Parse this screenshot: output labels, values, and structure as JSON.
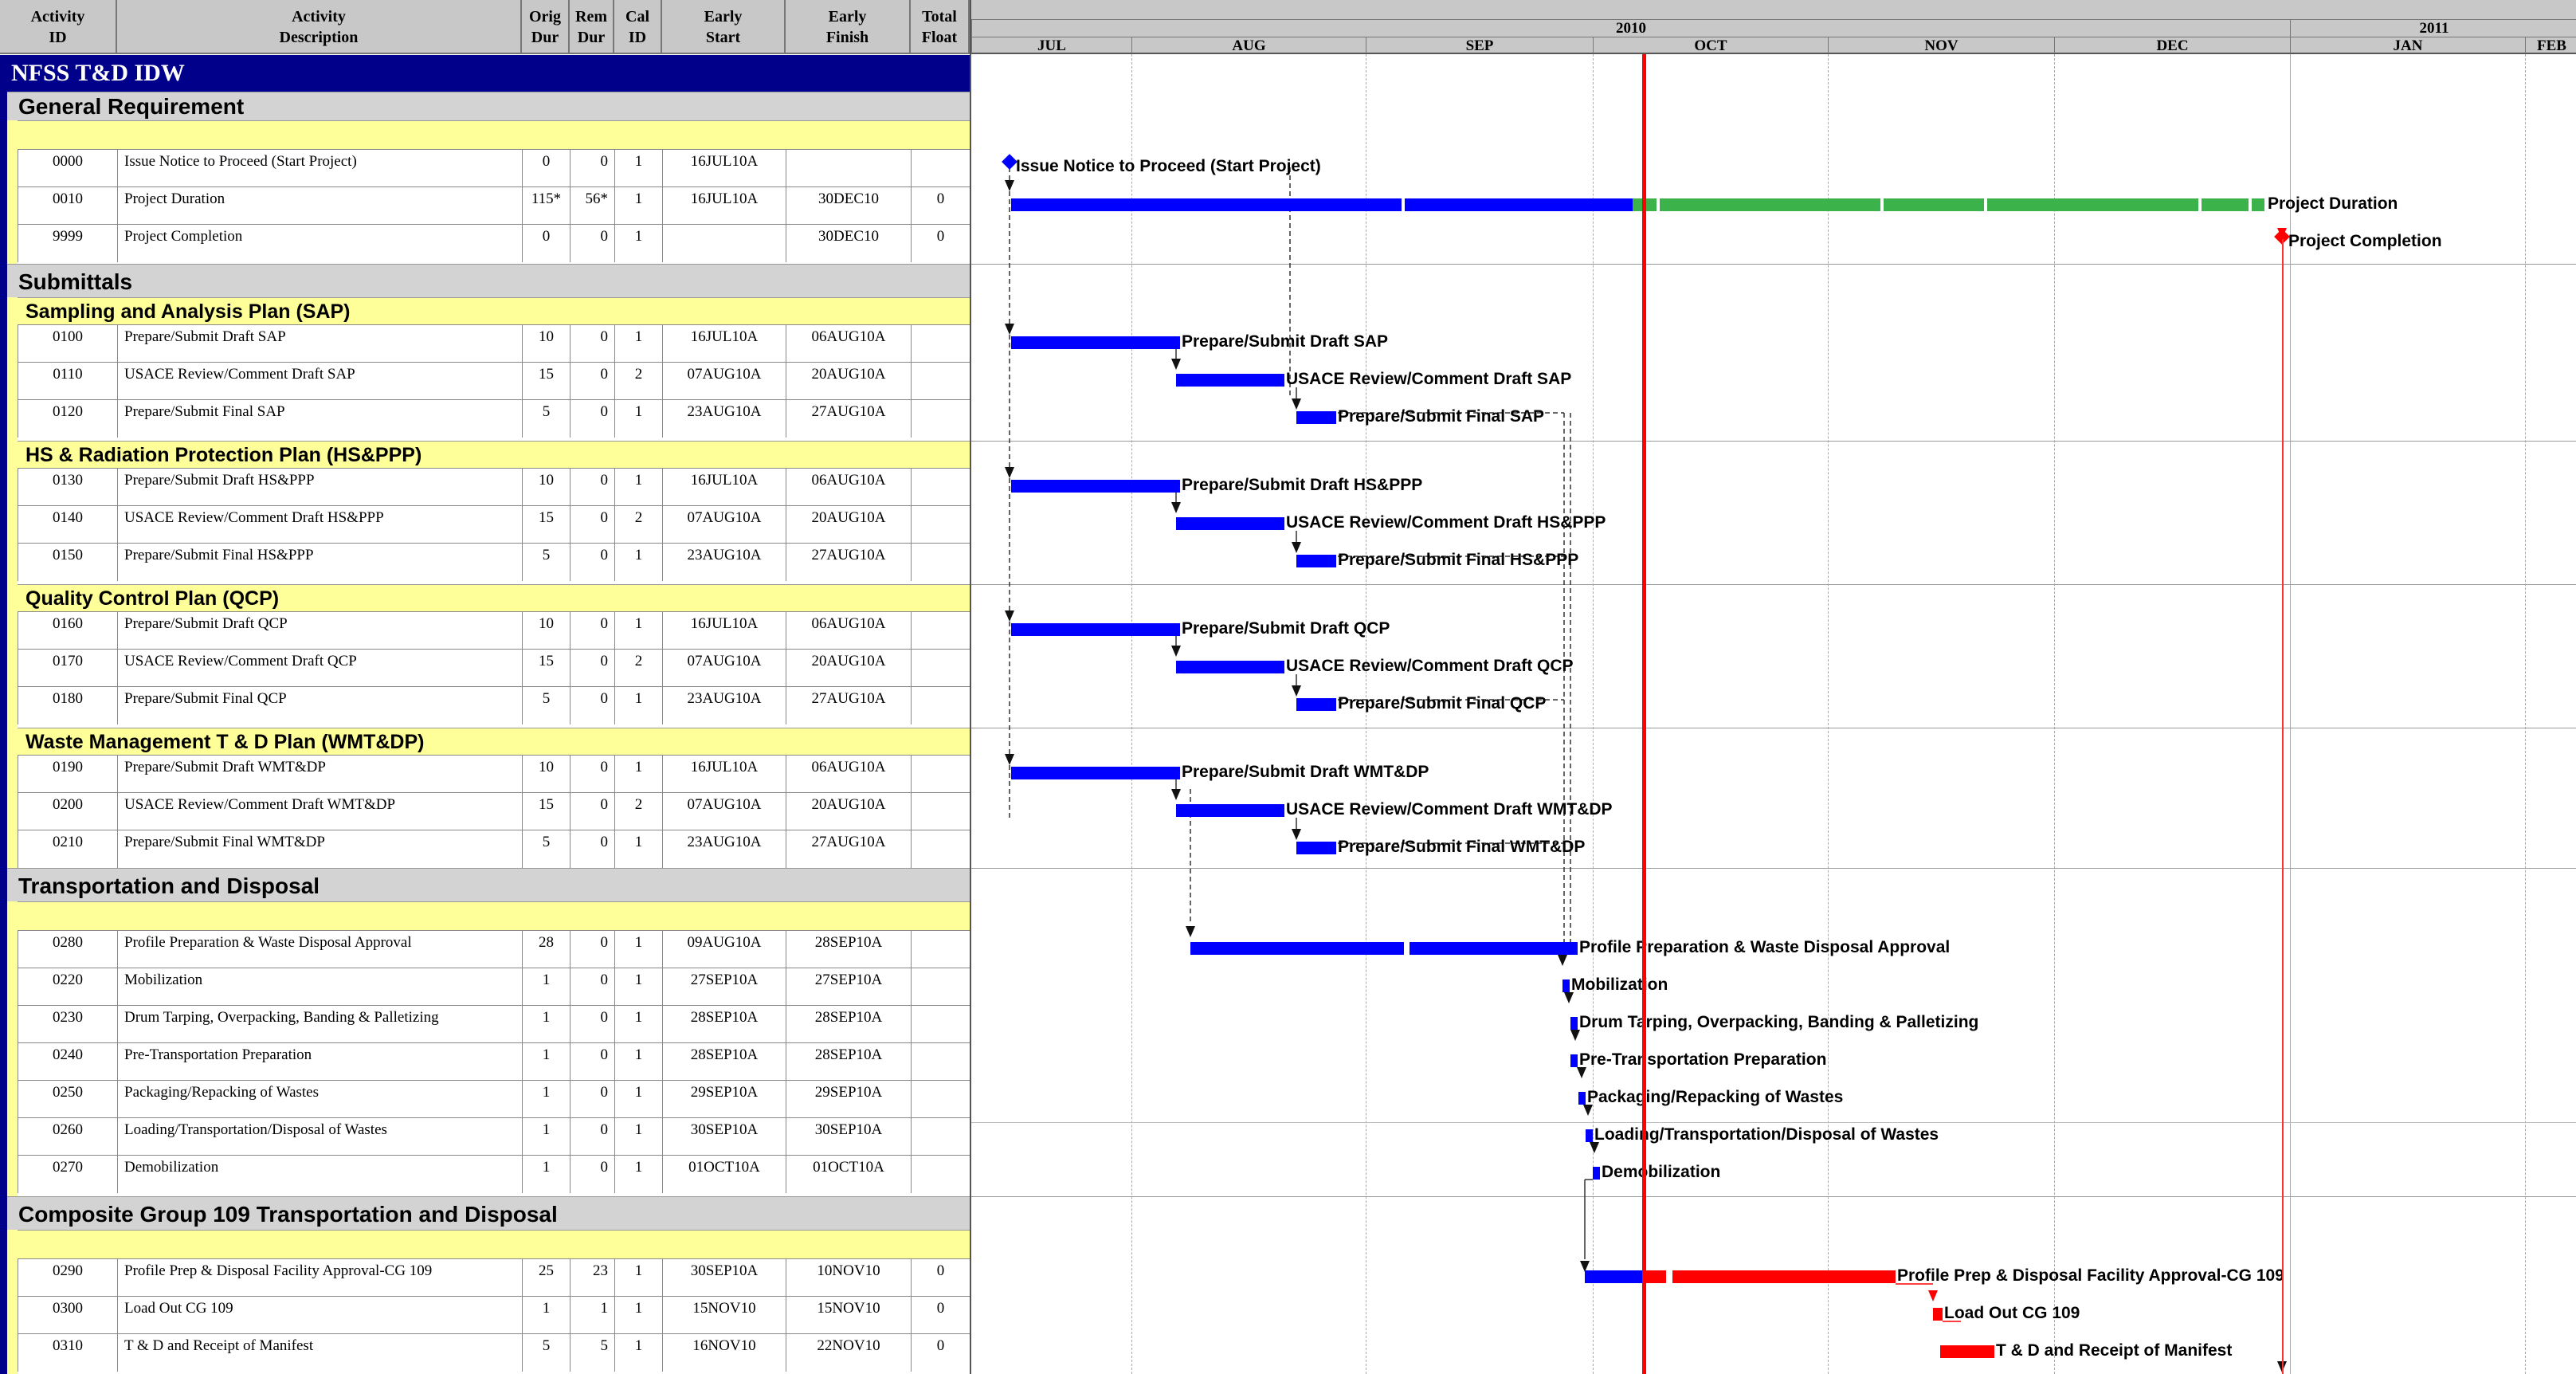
{
  "headers": [
    {
      "line1": "Activity",
      "line2": "ID"
    },
    {
      "line1": "Activity",
      "line2": "Description"
    },
    {
      "line1": "Orig",
      "line2": "Dur"
    },
    {
      "line1": "Rem",
      "line2": "Dur"
    },
    {
      "line1": "Cal",
      "line2": "ID"
    },
    {
      "line1": "Early",
      "line2": "Start"
    },
    {
      "line1": "Early",
      "line2": "Finish"
    },
    {
      "line1": "Total",
      "line2": "Float"
    }
  ],
  "project_title": "NFSS T&D IDW",
  "timescale": {
    "years": [
      "2010",
      "2011"
    ],
    "months": [
      "JUL",
      "AUG",
      "SEP",
      "OCT",
      "NOV",
      "DEC",
      "JAN",
      "FEB"
    ]
  },
  "colors": {
    "normal_bar": "#0000ff",
    "remaining_bar": "#3cb34a",
    "critical_bar": "#ff0000",
    "section_band": "#d3d3d3",
    "subsection_band": "#ffff99",
    "project_band": "#00008b",
    "data_date_line": "#ff0000"
  },
  "sections": {
    "general": "General Requirement",
    "submittals": "Submittals",
    "sap": "Sampling and Analysis Plan (SAP)",
    "hs": "HS & Radiation Protection Plan (HS&PPP)",
    "qcp": "Quality Control Plan (QCP)",
    "wm": "Waste Management T & D Plan (WMT&DP)",
    "td": "Transportation and Disposal",
    "cg": "Composite Group 109 Transportation and Disposal"
  },
  "activities": [
    {
      "id": "0000",
      "desc": "Issue Notice to Proceed (Start Project)",
      "orig": "0",
      "rem": "0",
      "cal": "1",
      "start": "16JUL10A",
      "finish": "",
      "float": "",
      "label": "Issue Notice to Proceed (Start Project)",
      "kind": "milestone-blue"
    },
    {
      "id": "0010",
      "desc": "Project Duration",
      "orig": "115*",
      "rem": "56*",
      "cal": "1",
      "start": "16JUL10A",
      "finish": "30DEC10",
      "float": "0",
      "label": "Project Duration",
      "kind": "summary"
    },
    {
      "id": "9999",
      "desc": "Project Completion",
      "orig": "0",
      "rem": "0",
      "cal": "1",
      "start": "",
      "finish": "30DEC10",
      "float": "0",
      "label": "Project Completion",
      "kind": "milestone-red"
    },
    {
      "id": "0100",
      "desc": "Prepare/Submit Draft SAP",
      "orig": "10",
      "rem": "0",
      "cal": "1",
      "start": "16JUL10A",
      "finish": "06AUG10A",
      "float": "",
      "label": "Prepare/Submit Draft SAP",
      "kind": "blue"
    },
    {
      "id": "0110",
      "desc": "USACE Review/Comment Draft SAP",
      "orig": "15",
      "rem": "0",
      "cal": "2",
      "start": "07AUG10A",
      "finish": "20AUG10A",
      "float": "",
      "label": "USACE Review/Comment Draft SAP",
      "kind": "blue"
    },
    {
      "id": "0120",
      "desc": "Prepare/Submit Final SAP",
      "orig": "5",
      "rem": "0",
      "cal": "1",
      "start": "23AUG10A",
      "finish": "27AUG10A",
      "float": "",
      "label": "Prepare/Submit Final SAP",
      "kind": "blue"
    },
    {
      "id": "0130",
      "desc": "Prepare/Submit Draft HS&PPP",
      "orig": "10",
      "rem": "0",
      "cal": "1",
      "start": "16JUL10A",
      "finish": "06AUG10A",
      "float": "",
      "label": "Prepare/Submit Draft HS&PPP",
      "kind": "blue"
    },
    {
      "id": "0140",
      "desc": "USACE Review/Comment Draft HS&PPP",
      "orig": "15",
      "rem": "0",
      "cal": "2",
      "start": "07AUG10A",
      "finish": "20AUG10A",
      "float": "",
      "label": "USACE Review/Comment Draft HS&PPP",
      "kind": "blue"
    },
    {
      "id": "0150",
      "desc": "Prepare/Submit Final HS&PPP",
      "orig": "5",
      "rem": "0",
      "cal": "1",
      "start": "23AUG10A",
      "finish": "27AUG10A",
      "float": "",
      "label": "Prepare/Submit Final HS&PPP",
      "kind": "blue"
    },
    {
      "id": "0160",
      "desc": "Prepare/Submit Draft QCP",
      "orig": "10",
      "rem": "0",
      "cal": "1",
      "start": "16JUL10A",
      "finish": "06AUG10A",
      "float": "",
      "label": "Prepare/Submit Draft QCP",
      "kind": "blue"
    },
    {
      "id": "0170",
      "desc": "USACE Review/Comment Draft QCP",
      "orig": "15",
      "rem": "0",
      "cal": "2",
      "start": "07AUG10A",
      "finish": "20AUG10A",
      "float": "",
      "label": "USACE Review/Comment Draft QCP",
      "kind": "blue"
    },
    {
      "id": "0180",
      "desc": "Prepare/Submit Final QCP",
      "orig": "5",
      "rem": "0",
      "cal": "1",
      "start": "23AUG10A",
      "finish": "27AUG10A",
      "float": "",
      "label": "Prepare/Submit Final QCP",
      "kind": "blue"
    },
    {
      "id": "0190",
      "desc": "Prepare/Submit Draft WMT&DP",
      "orig": "10",
      "rem": "0",
      "cal": "1",
      "start": "16JUL10A",
      "finish": "06AUG10A",
      "float": "",
      "label": "Prepare/Submit Draft WMT&DP",
      "kind": "blue"
    },
    {
      "id": "0200",
      "desc": "USACE Review/Comment Draft WMT&DP",
      "orig": "15",
      "rem": "0",
      "cal": "2",
      "start": "07AUG10A",
      "finish": "20AUG10A",
      "float": "",
      "label": "USACE Review/Comment Draft WMT&DP",
      "kind": "blue"
    },
    {
      "id": "0210",
      "desc": "Prepare/Submit Final WMT&DP",
      "orig": "5",
      "rem": "0",
      "cal": "1",
      "start": "23AUG10A",
      "finish": "27AUG10A",
      "float": "",
      "label": "Prepare/Submit Final WMT&DP",
      "kind": "blue"
    },
    {
      "id": "0280",
      "desc": "Profile Preparation & Waste Disposal Approval",
      "orig": "28",
      "rem": "0",
      "cal": "1",
      "start": "09AUG10A",
      "finish": "28SEP10A",
      "float": "",
      "label": "Profile Preparation & Waste Disposal Approval",
      "kind": "blue"
    },
    {
      "id": "0220",
      "desc": "Mobilization",
      "orig": "1",
      "rem": "0",
      "cal": "1",
      "start": "27SEP10A",
      "finish": "27SEP10A",
      "float": "",
      "label": "Mobilization",
      "kind": "blue"
    },
    {
      "id": "0230",
      "desc": "Drum Tarping, Overpacking, Banding & Palletizing",
      "orig": "1",
      "rem": "0",
      "cal": "1",
      "start": "28SEP10A",
      "finish": "28SEP10A",
      "float": "",
      "label": "Drum Tarping, Overpacking, Banding & Palletizing",
      "kind": "blue"
    },
    {
      "id": "0240",
      "desc": "Pre-Transportation Preparation",
      "orig": "1",
      "rem": "0",
      "cal": "1",
      "start": "28SEP10A",
      "finish": "28SEP10A",
      "float": "",
      "label": "Pre-Transportation Preparation",
      "kind": "blue"
    },
    {
      "id": "0250",
      "desc": "Packaging/Repacking of Wastes",
      "orig": "1",
      "rem": "0",
      "cal": "1",
      "start": "29SEP10A",
      "finish": "29SEP10A",
      "float": "",
      "label": "Packaging/Repacking of Wastes",
      "kind": "blue"
    },
    {
      "id": "0260",
      "desc": "Loading/Transportation/Disposal of Wastes",
      "orig": "1",
      "rem": "0",
      "cal": "1",
      "start": "30SEP10A",
      "finish": "30SEP10A",
      "float": "",
      "label": "Loading/Transportation/Disposal of Wastes",
      "kind": "blue"
    },
    {
      "id": "0270",
      "desc": "Demobilization",
      "orig": "1",
      "rem": "0",
      "cal": "1",
      "start": "01OCT10A",
      "finish": "01OCT10A",
      "float": "",
      "label": "Demobilization",
      "kind": "blue"
    },
    {
      "id": "0290",
      "desc": "Profile Prep & Disposal Facility Approval-CG 109",
      "orig": "25",
      "rem": "23",
      "cal": "1",
      "start": "30SEP10A",
      "finish": "10NOV10",
      "float": "0",
      "label": "Profile Prep & Disposal Facility Approval-CG 109",
      "kind": "critical-mixed"
    },
    {
      "id": "0300",
      "desc": "Load Out CG 109",
      "orig": "1",
      "rem": "1",
      "cal": "1",
      "start": "15NOV10",
      "finish": "15NOV10",
      "float": "0",
      "label": "Load Out CG 109",
      "kind": "critical"
    },
    {
      "id": "0310",
      "desc": "T & D and Receipt of Manifest",
      "orig": "5",
      "rem": "5",
      "cal": "1",
      "start": "16NOV10",
      "finish": "22NOV10",
      "float": "0",
      "label": "T & D and Receipt of Manifest",
      "kind": "critical"
    }
  ]
}
